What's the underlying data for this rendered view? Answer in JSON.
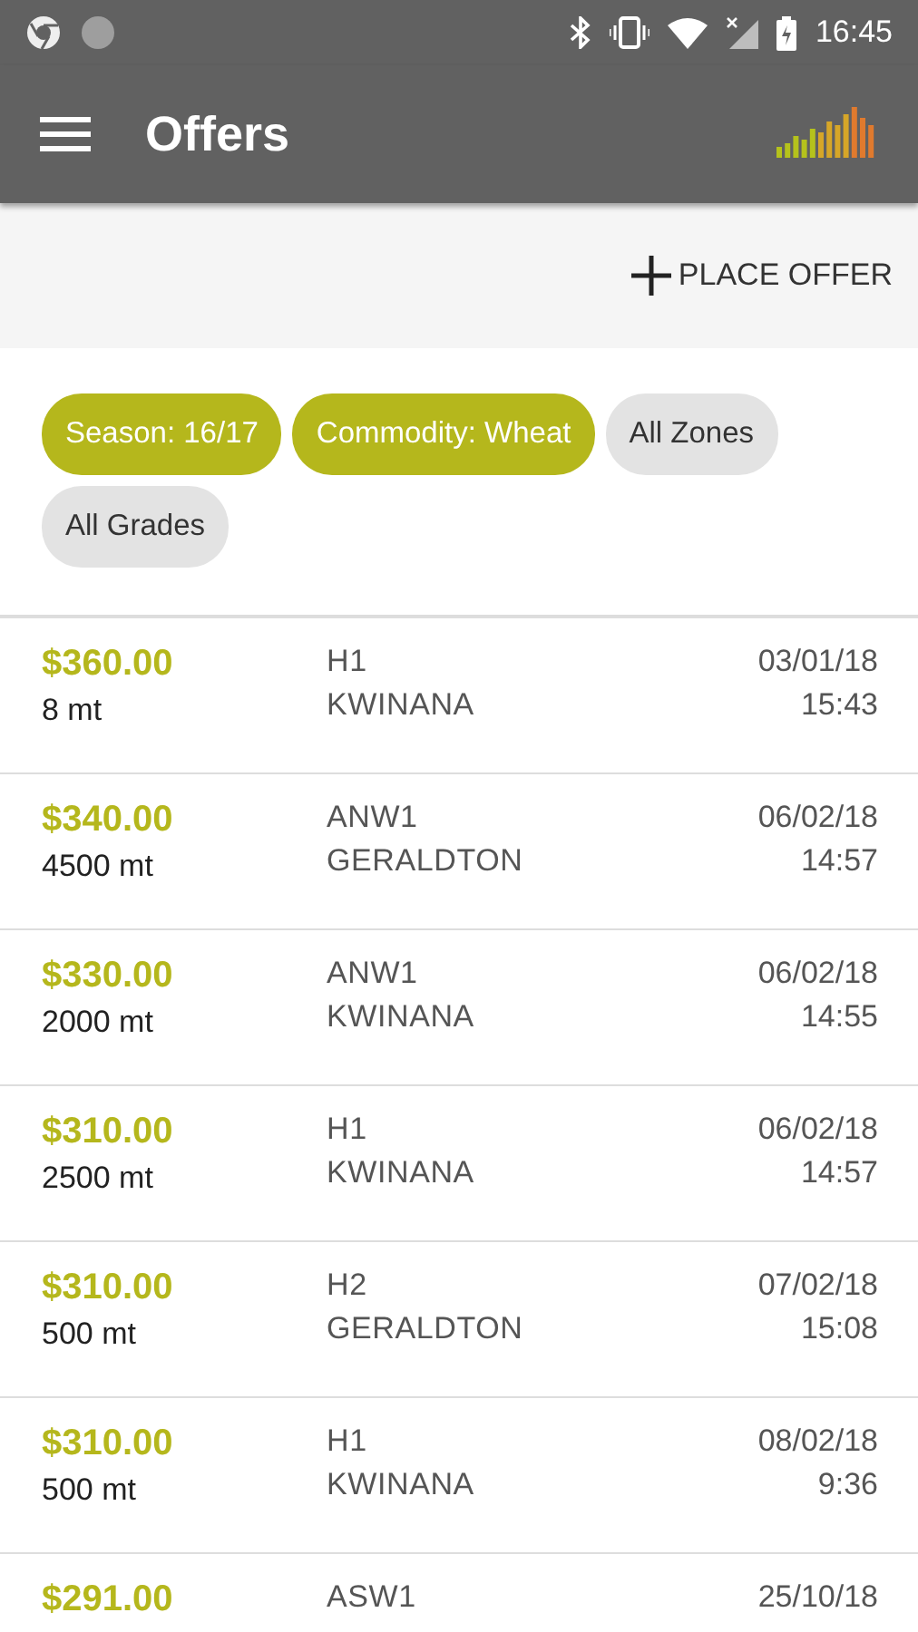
{
  "status_bar": {
    "time": "16:45"
  },
  "app_bar": {
    "title": "Offers"
  },
  "action": {
    "label": "PLACE OFFER"
  },
  "filters": [
    {
      "label": "Season: 16/17",
      "selected": true
    },
    {
      "label": "Commodity: Wheat",
      "selected": true
    },
    {
      "label": "All Zones",
      "selected": false
    },
    {
      "label": "All Grades",
      "selected": false
    }
  ],
  "offers": [
    {
      "price": "$360.00",
      "quantity": "8 mt",
      "grade": "H1",
      "port": "KWINANA",
      "date": "03/01/18",
      "time": "15:43"
    },
    {
      "price": "$340.00",
      "quantity": "4500 mt",
      "grade": "ANW1",
      "port": "GERALDTON",
      "date": "06/02/18",
      "time": "14:57"
    },
    {
      "price": "$330.00",
      "quantity": "2000 mt",
      "grade": "ANW1",
      "port": "KWINANA",
      "date": "06/02/18",
      "time": "14:55"
    },
    {
      "price": "$310.00",
      "quantity": "2500 mt",
      "grade": "H1",
      "port": "KWINANA",
      "date": "06/02/18",
      "time": "14:57"
    },
    {
      "price": "$310.00",
      "quantity": "500 mt",
      "grade": "H2",
      "port": "GERALDTON",
      "date": "07/02/18",
      "time": "15:08"
    },
    {
      "price": "$310.00",
      "quantity": "500 mt",
      "grade": "H1",
      "port": "KWINANA",
      "date": "08/02/18",
      "time": "9:36"
    },
    {
      "price": "$291.00",
      "grade": "ASW1",
      "date": "25/10/18"
    }
  ]
}
